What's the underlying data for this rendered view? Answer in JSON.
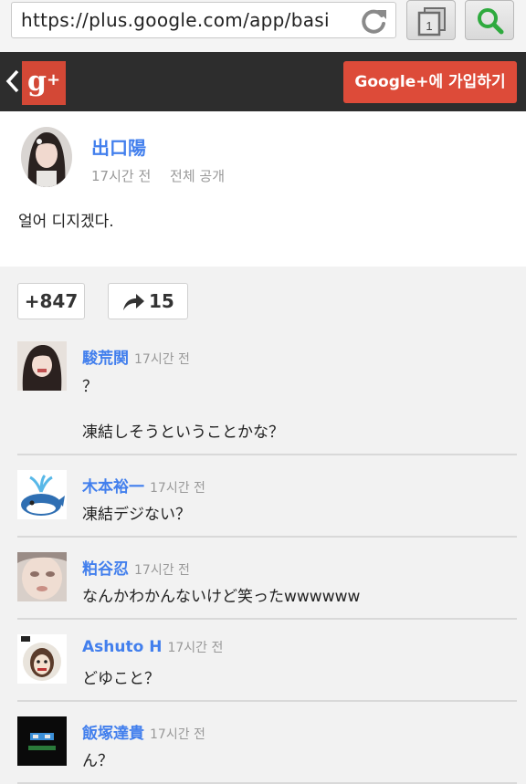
{
  "browser": {
    "url": "https://plus.google.com/app/basi…",
    "tab_count": "1"
  },
  "header": {
    "join_label": "Google+에 가입하기",
    "logo_text": "g",
    "logo_plus": "+"
  },
  "post": {
    "author": "出口陽",
    "time": "17시간 전",
    "visibility": "전체 공개",
    "text": "얼어 디지겠다.",
    "plus_count": "+847",
    "share_count": "15"
  },
  "comments": [
    {
      "name": "駿荒関",
      "time": "17시간 전",
      "lines": [
        "？",
        "凍結しそうということかな？"
      ]
    },
    {
      "name": "木本裕一",
      "time": "17시간 전",
      "lines": [
        "凍結デジない？"
      ]
    },
    {
      "name": "粕谷忍",
      "time": "17시간 전",
      "lines": [
        "なんかわかんないけど笑ったwwwwww"
      ]
    },
    {
      "name": "Ashuto H",
      "time": "17시간 전",
      "lines": [
        "どゆこと？"
      ]
    },
    {
      "name": "飯塚達貴",
      "time": "17시간 전",
      "lines": [
        "ん？"
      ]
    }
  ],
  "colors": {
    "accent_blue": "#427fed",
    "google_red": "#dd4b39",
    "header_dark": "#2d2d2d"
  }
}
